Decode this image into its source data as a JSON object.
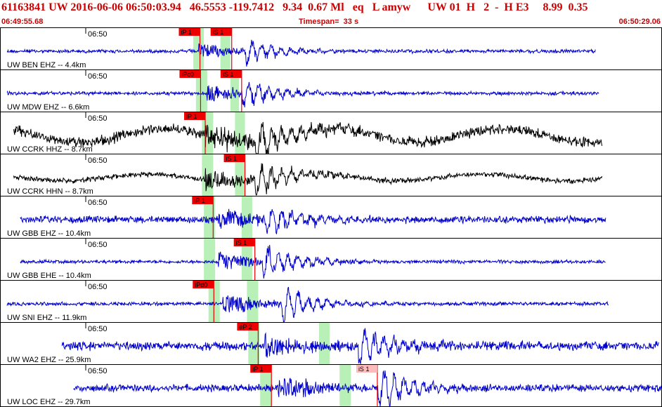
{
  "header": {
    "title": "61163841 UW 2016-06-06 06:50:03.94   46.5553 -119.7412   9.34  0.67 Ml   eq   L amyw      UW 01  H   2  -  H E3     8.99  0.35",
    "start_time": "06:49:55.68",
    "timespan": "Timespan=  33 s",
    "end_time": "06:50:29.06"
  },
  "colors": {
    "header_text": "#cc0000",
    "trace_blue": "#0000cc",
    "trace_black": "#000000",
    "pick_red": "#ee0000",
    "pick_pink": "#ffbbbb",
    "window_green": "#b8f0b8",
    "panel_border": "#000000"
  },
  "panels": [
    {
      "label": "UW BEN EHZ -- 4.4km",
      "tick": "06:50",
      "color": "blue",
      "amp": 7,
      "noise": 2,
      "start": 0.0,
      "end": 0.9,
      "pOnset": 0.3,
      "sOnset": 0.37,
      "green": [
        [
          0.292,
          0.308
        ],
        [
          0.333,
          0.348
        ]
      ],
      "picks": [
        {
          "label": "iP 1",
          "pos": 0.302,
          "type": "red"
        },
        {
          "label": "iS 1",
          "pos": 0.35,
          "type": "red"
        }
      ]
    },
    {
      "label": "UW MDW EHZ -- 6.6km",
      "tick": "06:50",
      "color": "blue",
      "amp": 8,
      "noise": 2,
      "start": 0.0,
      "end": 0.905,
      "pOnset": 0.312,
      "sOnset": 0.365,
      "green": [
        [
          0.296,
          0.313
        ],
        [
          0.348,
          0.361
        ]
      ],
      "picks": [
        {
          "label": "iPc0",
          "pos": 0.303,
          "type": "red"
        },
        {
          "label": "iS 1",
          "pos": 0.365,
          "type": "red"
        }
      ]
    },
    {
      "label": "UW CCRK HHZ -- 8.7km",
      "tick": "06:50",
      "color": "black",
      "amp": 12,
      "noise": 6,
      "start": 0.01,
      "end": 0.91,
      "pOnset": 0.31,
      "sOnset": 0.385,
      "green": [
        [
          0.305,
          0.322
        ],
        [
          0.355,
          0.37
        ]
      ],
      "picks": [
        {
          "label": "iP 1",
          "pos": 0.31,
          "type": "red"
        }
      ]
    },
    {
      "label": "UW CCRK HHN -- 8.7km",
      "tick": "06:50",
      "color": "black",
      "amp": 10,
      "noise": 3,
      "start": 0.01,
      "end": 0.91,
      "pOnset": 0.31,
      "sOnset": 0.385,
      "green": [
        [
          0.305,
          0.322
        ],
        [
          0.355,
          0.37
        ]
      ],
      "picks": [
        {
          "label": "iS 1",
          "pos": 0.37,
          "type": "red"
        }
      ]
    },
    {
      "label": "UW GBB EHZ -- 10.4km",
      "tick": "06:50",
      "color": "blue",
      "amp": 9,
      "noise": 4,
      "start": 0.02,
      "end": 0.915,
      "pOnset": 0.33,
      "sOnset": 0.4,
      "green": [
        [
          0.308,
          0.325
        ],
        [
          0.365,
          0.381
        ]
      ],
      "picks": [
        {
          "label": "iP 1",
          "pos": 0.322,
          "type": "red"
        }
      ]
    },
    {
      "label": "UW GBB EHE -- 10.4km",
      "tick": "06:50",
      "color": "blue",
      "amp": 9,
      "noise": 2,
      "start": 0.02,
      "end": 0.915,
      "pOnset": 0.33,
      "sOnset": 0.395,
      "green": [
        [
          0.308,
          0.325
        ],
        [
          0.365,
          0.381
        ]
      ],
      "picks": [
        {
          "label": "iS 1",
          "pos": 0.385,
          "type": "red"
        }
      ]
    },
    {
      "label": "UW SNI EHZ -- 11.9km",
      "tick": "06:50",
      "color": "blue",
      "amp": 10,
      "noise": 2,
      "start": 0.0,
      "end": 0.92,
      "pOnset": 0.335,
      "sOnset": 0.425,
      "green": [
        [
          0.315,
          0.332
        ],
        [
          0.373,
          0.39
        ]
      ],
      "picks": [
        {
          "label": "iPd0",
          "pos": 0.323,
          "type": "red"
        }
      ]
    },
    {
      "label": "UW WA2 EHZ -- 25.9km",
      "tick": "06:50",
      "color": "blue",
      "amp": 11,
      "noise": 5,
      "start": 0.083,
      "end": 0.995,
      "pOnset": 0.4,
      "sOnset": 0.54,
      "green": [
        [
          0.375,
          0.392
        ],
        [
          0.482,
          0.498
        ]
      ],
      "picks": [
        {
          "label": "eP 2",
          "pos": 0.39,
          "type": "red"
        }
      ]
    },
    {
      "label": "UW LOC EHZ -- 29.7km",
      "tick": "06:50",
      "color": "blue",
      "amp": 12,
      "noise": 4,
      "start": 0.1,
      "end": 1.0,
      "pOnset": 0.42,
      "sOnset": 0.57,
      "green": [
        [
          0.393,
          0.41
        ],
        [
          0.513,
          0.53
        ]
      ],
      "picks": [
        {
          "label": "iP 1",
          "pos": 0.41,
          "type": "red"
        },
        {
          "label": "iS 1",
          "pos": 0.57,
          "type": "pink"
        }
      ]
    }
  ]
}
